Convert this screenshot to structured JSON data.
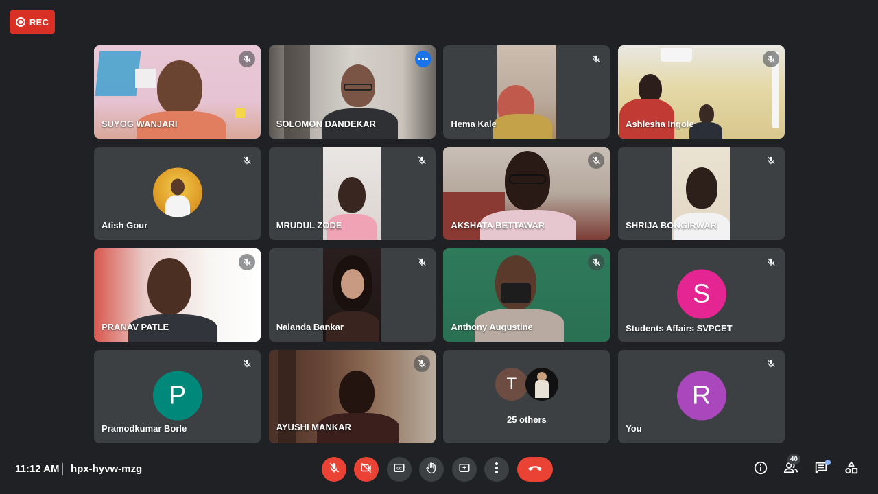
{
  "recording": {
    "label": "REC",
    "color": "#d93025"
  },
  "meeting": {
    "time": "11:12 AM",
    "code": "hpx-hyvw-mzg"
  },
  "participants": [
    {
      "name": "SUYOG WANJARI",
      "video": true,
      "muted": true
    },
    {
      "name": "SOLOMON DANDEKAR",
      "video": true,
      "muted": false,
      "active_speaker": true
    },
    {
      "name": "Hema Kale",
      "video": true,
      "muted": true
    },
    {
      "name": "Ashlesha Ingole",
      "video": true,
      "muted": true
    },
    {
      "name": "Atish Gour",
      "video": false,
      "muted": true,
      "avatar": "photo"
    },
    {
      "name": "MRUDUL ZODE",
      "video": true,
      "muted": true
    },
    {
      "name": "AKSHATA BETTAWAR",
      "video": true,
      "muted": true
    },
    {
      "name": "SHRIJA BONGIRWAR",
      "video": true,
      "muted": true
    },
    {
      "name": "PRANAV PATLE",
      "video": true,
      "muted": true
    },
    {
      "name": "Nalanda Bankar",
      "video": true,
      "muted": true
    },
    {
      "name": "Anthony Augustine",
      "video": true,
      "muted": true
    },
    {
      "name": "Students Affairs SVPCET",
      "video": false,
      "muted": true,
      "initial": "S",
      "color": "#e52592"
    },
    {
      "name": "Pramodkumar Borle",
      "video": false,
      "muted": true,
      "initial": "P",
      "color": "#00897b"
    },
    {
      "name": "AYUSHI MANKAR",
      "video": true,
      "muted": true
    },
    {
      "name": "You",
      "video": false,
      "muted": true,
      "initial": "R",
      "color": "#ab47bc"
    }
  ],
  "others": {
    "initial": "T",
    "label": "25 others"
  },
  "controls": {
    "mic": "mic-off-icon",
    "camera": "camera-off-icon",
    "captions": "captions-icon",
    "raise_hand": "hand-icon",
    "present": "present-screen-icon",
    "more": "more-vert-icon",
    "leave": "call-end-icon"
  },
  "right_controls": {
    "people_count": "40"
  },
  "colors": {
    "background": "#202124",
    "tile": "#3c4043",
    "accent": "#8ab4f8",
    "danger": "#ea4335"
  }
}
